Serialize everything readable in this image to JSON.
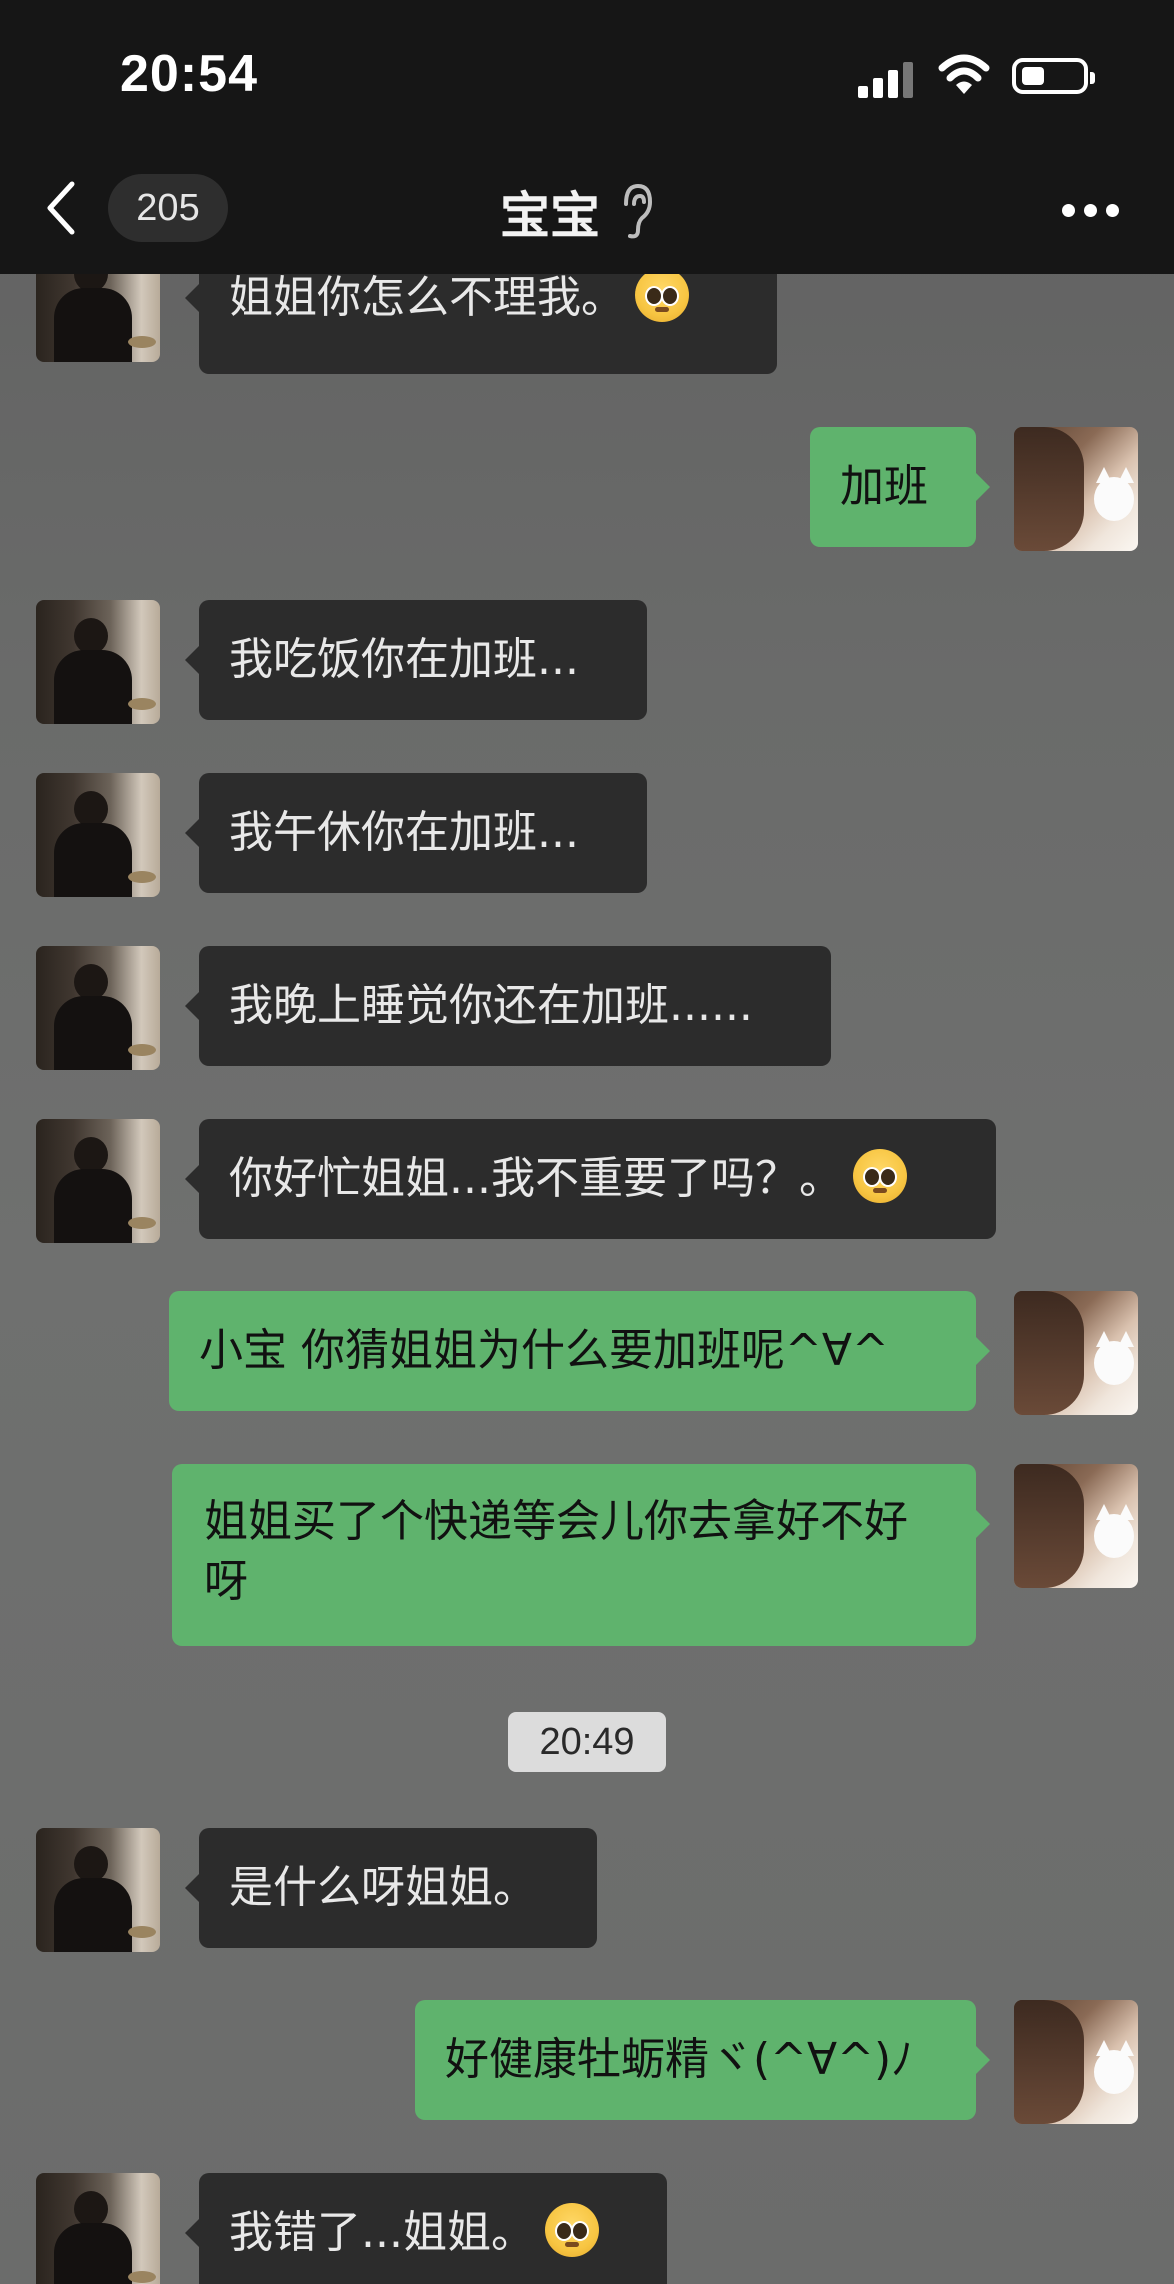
{
  "status_bar": {
    "time": "20:54"
  },
  "nav": {
    "back_count": "205",
    "title": "宝宝"
  },
  "timestamp": "20:49",
  "messages": [
    {
      "side": "left",
      "text": "姐姐你怎么不理我。",
      "emoji": "pleading-face"
    },
    {
      "side": "right",
      "text": "加班"
    },
    {
      "side": "left",
      "text": "我吃饭你在加班..."
    },
    {
      "side": "left",
      "text": "我午休你在加班..."
    },
    {
      "side": "left",
      "text": "我晚上睡觉你还在加班......"
    },
    {
      "side": "left",
      "text": "你好忙姐姐...我不重要了吗？。",
      "emoji": "pleading-face"
    },
    {
      "side": "right",
      "text": "小宝 你猜姐姐为什么要加班呢^∀^"
    },
    {
      "side": "right",
      "text": "姐姐买了个快递等会儿你去拿好不好呀"
    },
    {
      "side": "left",
      "text": "是什么呀姐姐。"
    },
    {
      "side": "right",
      "text": "好健康牡蛎精ヾ(^∀^)ﾉ"
    },
    {
      "side": "left",
      "text": "我错了...姐姐。",
      "emoji": "pleading-face"
    }
  ],
  "colors": {
    "sent_bubble": "#5fb36d",
    "received_bubble": "#2c2c2c",
    "header": "#161616"
  }
}
